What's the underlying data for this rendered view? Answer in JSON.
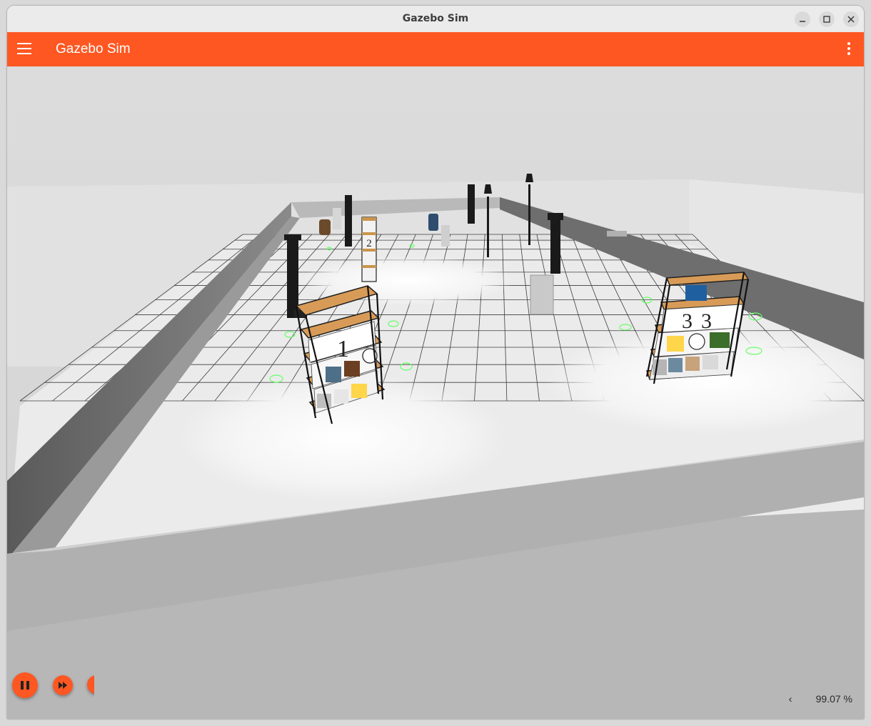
{
  "window": {
    "title": "Gazebo Sim"
  },
  "appbar": {
    "title": "Gazebo Sim"
  },
  "scene": {
    "shelf_labels": [
      "1",
      "2",
      "3"
    ]
  },
  "controls": {
    "real_time_factor": "99.07 %",
    "collapse_glyph": "‹"
  },
  "colors": {
    "accent": "#ff5722",
    "titlebar": "#ebebeb",
    "ground_grid": "#3c3c3c",
    "marker": "#66ff66"
  },
  "icons": {
    "menu": "hamburger-icon",
    "more": "more-vert-icon",
    "pause": "pause-icon",
    "step": "fast-forward-icon"
  }
}
